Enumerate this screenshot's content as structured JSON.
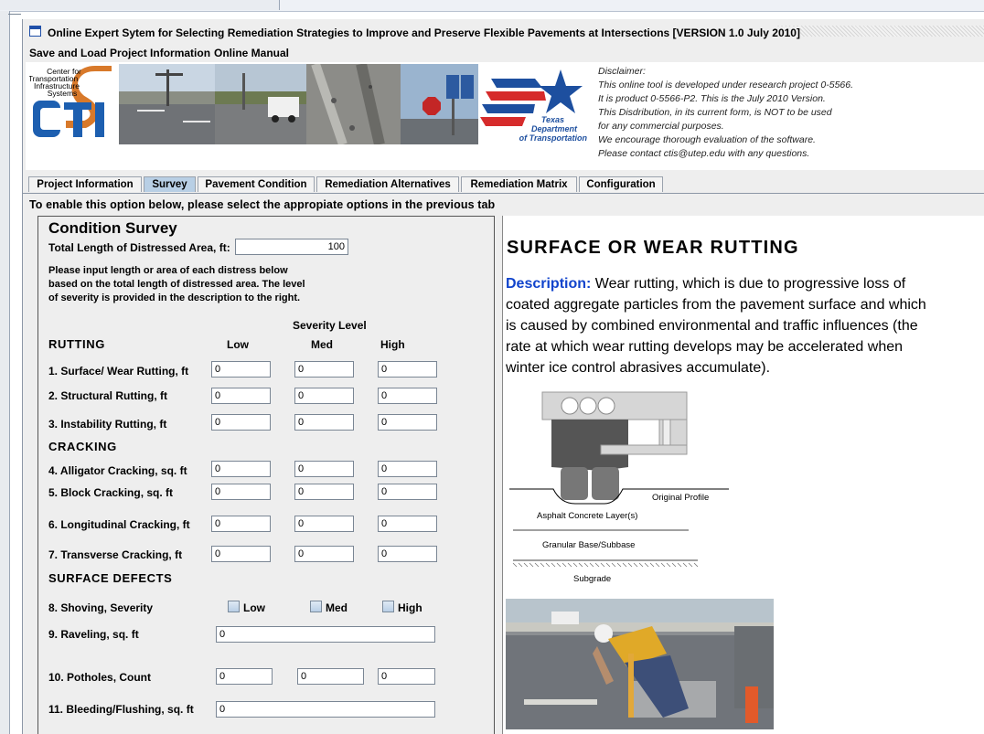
{
  "window": {
    "title": "Online Expert Sytem for Selecting Remediation Strategies to Improve and Preserve Flexible Pavements at Intersections [VERSION 1.0 July 2010]"
  },
  "menu": [
    "Save and Load Project Information",
    "Online Manual"
  ],
  "banner": {
    "logo_line1": "Center for",
    "logo_line2": "Transportation",
    "logo_line3": "Infrastructure",
    "logo_line4": "Systems",
    "logo_mark": "CTIS",
    "txdot_line1": "Texas",
    "txdot_line2": "Department",
    "txdot_line3": "of Transportation",
    "disclaimer": [
      "Disclaimer:",
      "This online tool is developed under research project 0-5566.",
      "It is product 0-5566-P2. This is the July 2010 Version.",
      "This Disdribution, in its current form, is NOT to be used",
      "for any commercial purposes.",
      "We encourage thorough evaluation of the software.",
      "Please contact ctis@utep.edu with any questions."
    ]
  },
  "tabs": [
    "Project Information",
    "Survey",
    "Pavement Condition",
    "Remediation Alternatives",
    "Remediation Matrix",
    "Configuration"
  ],
  "active_tab": "Survey",
  "notice": "To enable this option below, please select the appropiate options in the previous tab",
  "survey": {
    "heading": "Condition Survey",
    "total_label": "Total Length of Distressed Area, ft:",
    "total_value": "100",
    "instructions": [
      "Please input length or area of each distress below",
      "based on the total length of distressed area. The level",
      "of severity is provided in the description to the right."
    ],
    "severity_header": "Severity Level",
    "levels": [
      "Low",
      "Med",
      "High"
    ],
    "sections": {
      "rutting": "RUTTING",
      "cracking": "CRACKING",
      "surface": "SURFACE DEFECTS"
    },
    "rows": [
      {
        "label": "1. Surface/ Wear Rutting, ft",
        "low": "0",
        "med": "0",
        "high": "0"
      },
      {
        "label": "2. Structural Rutting, ft",
        "low": "0",
        "med": "0",
        "high": "0"
      },
      {
        "label": "3. Instability Rutting, ft",
        "low": "0",
        "med": "0",
        "high": "0"
      },
      {
        "label": "4. Alligator Cracking, sq. ft",
        "low": "0",
        "med": "0",
        "high": "0"
      },
      {
        "label": "5. Block Cracking, sq. ft",
        "low": "0",
        "med": "0",
        "high": "0"
      },
      {
        "label": "6. Longitudinal Cracking, ft",
        "low": "0",
        "med": "0",
        "high": "0"
      },
      {
        "label": "7. Transverse Cracking, ft",
        "low": "0",
        "med": "0",
        "high": "0"
      }
    ],
    "shoving_label": "8. Shoving, Severity",
    "raveling_label": "9. Raveling, sq. ft",
    "raveling_value": "0",
    "potholes_label": "10. Potholes, Count",
    "potholes": {
      "low": "0",
      "med": "0",
      "high": "0"
    },
    "bleeding_label": "11. Bleeding/Flushing, sq. ft",
    "bleeding_value": "0"
  },
  "description": {
    "heading": "SURFACE OR WEAR RUTTING",
    "keyword": "Description:",
    "lines": [
      " Wear rutting, which is due to progressive loss of",
      "coated aggregate particles from the pavement surface and which",
      "is caused by combined environmental and traffic influences (the",
      "rate at which wear rutting develops may be accelerated when",
      "winter ice control abrasives accumulate)."
    ],
    "diagram": {
      "original_profile": "Original Profile",
      "asphalt": "Asphalt Concrete Layer(s)",
      "base": "Granular Base/Subbase",
      "subgrade": "Subgrade"
    }
  },
  "colors": {
    "accent_blue": "#1144cc",
    "active_tab": "#b8cfe5",
    "txdot_blue": "#1d4f9f",
    "txdot_red": "#d62b2b"
  }
}
